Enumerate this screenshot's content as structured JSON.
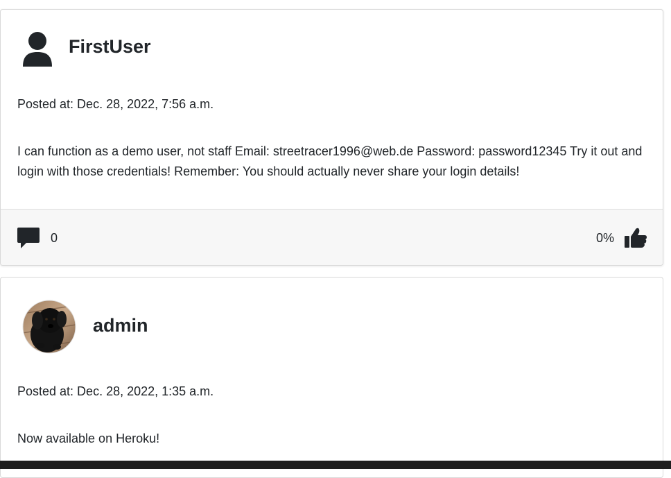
{
  "posts": [
    {
      "username": "FirstUser",
      "avatar_icon": "user-silhouette-icon",
      "posted_at": "Posted at: Dec. 28, 2022, 7:56 a.m.",
      "content": "I can function as a demo user, not staff Email: streetracer1996@web.de Password: password12345 Try it out and login with those credentials! Remember: You should actually never share your login details!",
      "comment_count": "0",
      "like_percent": "0%"
    },
    {
      "username": "admin",
      "avatar_icon": "dog-photo-avatar",
      "posted_at": "Posted at: Dec. 28, 2022, 1:35 a.m.",
      "content": "Now available on Heroku!"
    }
  ],
  "icons": {
    "comment": "comment-icon",
    "like": "thumbs-up-icon"
  },
  "colors": {
    "text": "#212529",
    "footer_bg": "#f7f7f7",
    "bottom_bar": "#1f1f1f"
  }
}
